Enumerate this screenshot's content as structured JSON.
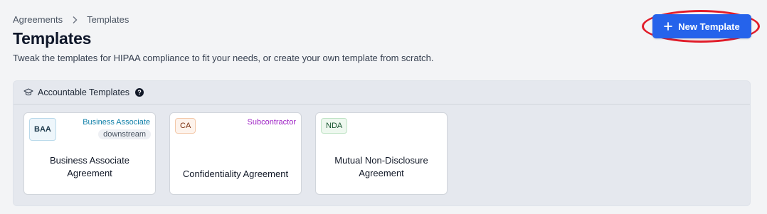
{
  "breadcrumb": {
    "root": "Agreements",
    "current": "Templates"
  },
  "page": {
    "title": "Templates",
    "description": "Tweak the templates for HIPAA compliance to fit your needs, or create your own template from scratch."
  },
  "actions": {
    "new_template": "New Template"
  },
  "section": {
    "title": "Accountable Templates",
    "help": "?"
  },
  "cards": [
    {
      "badge": "BAA",
      "tag": "Business Associate",
      "pill": "downstream",
      "title_line1": "Business Associate",
      "title_line2": "Agreement"
    },
    {
      "badge": "CA",
      "tag": "Subcontractor",
      "title": "Confidentiality Agreement"
    },
    {
      "badge": "NDA",
      "title_line1": "Mutual Non-Disclosure",
      "title_line2": "Agreement"
    }
  ],
  "colors": {
    "primary": "#2563eb",
    "highlight_ring": "#e11d2a",
    "tag_blue": "#0e7fa8",
    "tag_purple": "#9d1fc4"
  },
  "icons": {
    "breadcrumb_separator": "chevron-right-icon",
    "new_button": "plus-icon",
    "section": "graduation-cap-icon",
    "help": "question-circle-icon"
  }
}
